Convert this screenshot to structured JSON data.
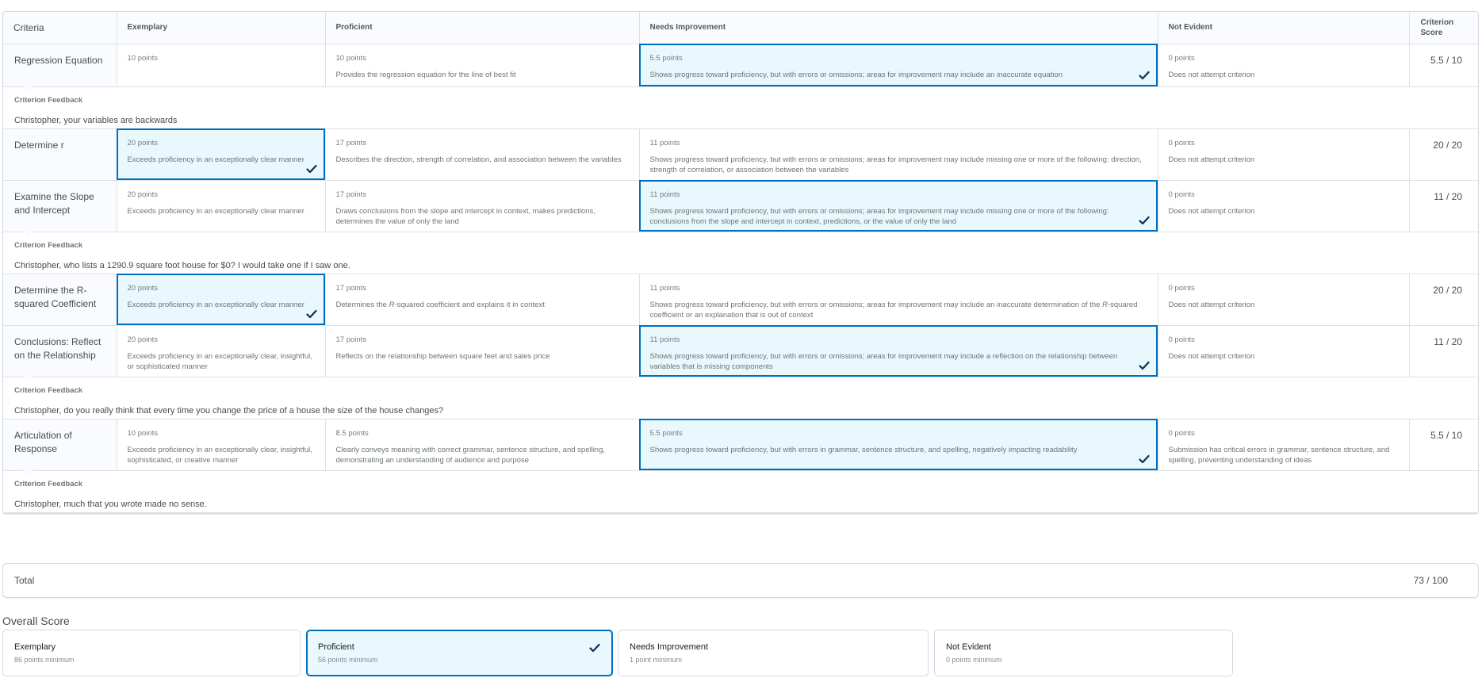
{
  "headers": {
    "criteria": "Criteria",
    "levels": [
      "Exemplary",
      "Proficient",
      "Needs Improvement",
      "Not Evident"
    ],
    "score": "Criterion Score"
  },
  "criteria": [
    {
      "name": "Regression Equation",
      "score": "5.5 / 10",
      "selected": 2,
      "cells": [
        {
          "points": "10 points",
          "desc": ""
        },
        {
          "points": "10 points",
          "desc": "Provides the regression equation for the line of best fit"
        },
        {
          "points": "5.5 points",
          "desc": "Shows progress toward proficiency, but with errors or omissions; areas for improvement may include an inaccurate equation"
        },
        {
          "points": "0 points",
          "desc": "Does not attempt criterion"
        }
      ],
      "feedback": "Christopher, your variables are backwards"
    },
    {
      "name": "Determine r",
      "score": "20 / 20",
      "selected": 0,
      "cells": [
        {
          "points": "20 points",
          "desc": "Exceeds proficiency in an exceptionally clear manner"
        },
        {
          "points": "17 points",
          "desc": "Describes the direction, strength of correlation, and association between the variables"
        },
        {
          "points": "11 points",
          "desc": "Shows progress toward proficiency, but with errors or omissions; areas for improvement may include missing one or more of the following: direction, strength of correlation, or association between the variables"
        },
        {
          "points": "0 points",
          "desc": "Does not attempt criterion"
        }
      ],
      "feedback": ""
    },
    {
      "name": "Examine the Slope and Intercept",
      "score": "11 / 20",
      "selected": 2,
      "cells": [
        {
          "points": "20 points",
          "desc": "Exceeds proficiency in an exceptionally clear manner"
        },
        {
          "points": "17 points",
          "desc": "Draws conclusions from the slope and intercept in context, makes predictions, determines the value of only the land"
        },
        {
          "points": "11 points",
          "desc": "Shows progress toward proficiency, but with errors or omissions; areas for improvement may include missing one or more of the following: conclusions from the slope and intercept in context, predictions, or the value of only the land"
        },
        {
          "points": "0 points",
          "desc": "Does not attempt criterion"
        }
      ],
      "feedback": "Christopher, who lists a 1290.9 square foot house for $0? I would take one if I saw one."
    },
    {
      "name": "Determine the R-squared Coefficient",
      "score": "20 / 20",
      "selected": 0,
      "cells": [
        {
          "points": "20 points",
          "desc": "Exceeds proficiency in an exceptionally clear manner"
        },
        {
          "points": "17 points",
          "desc": "Determines the R-squared coefficient and explains it in context"
        },
        {
          "points": "11 points",
          "desc": "Shows progress toward proficiency, but with errors or omissions; areas for improvement may include an inaccurate determination of the R-squared coefficient or an explanation that is out of context"
        },
        {
          "points": "0 points",
          "desc": "Does not attempt criterion"
        }
      ],
      "feedback": ""
    },
    {
      "name": "Conclusions: Reflect on the Relationship",
      "score": "11 / 20",
      "selected": 2,
      "cells": [
        {
          "points": "20 points",
          "desc": "Exceeds proficiency in an exceptionally clear, insightful, or sophisticated manner"
        },
        {
          "points": "17 points",
          "desc": "Reflects on the relationship between square feet and sales price"
        },
        {
          "points": "11 points",
          "desc": "Shows progress toward proficiency, but with errors or omissions; areas for improvement may include a reflection on the relationship between variables that is missing components"
        },
        {
          "points": "0 points",
          "desc": "Does not attempt criterion"
        }
      ],
      "feedback": "Christopher, do you really think that every time you change the price of a house the size of the house changes?"
    },
    {
      "name": "Articulation of Response",
      "score": "5.5 / 10",
      "selected": 2,
      "cells": [
        {
          "points": "10 points",
          "desc": "Exceeds proficiency in an exceptionally clear, insightful, sophisticated, or creative manner"
        },
        {
          "points": "8.5 points",
          "desc": "Clearly conveys meaning with correct grammar, sentence structure, and spelling, demonstrating an understanding of audience and purpose"
        },
        {
          "points": "5.5 points",
          "desc": "Shows progress toward proficiency, but with errors in grammar, sentence structure, and spelling, negatively impacting readability"
        },
        {
          "points": "0 points",
          "desc": "Submission has critical errors in grammar, sentence structure, and spelling, preventing understanding of ideas"
        }
      ],
      "feedback": "Christopher, much that you wrote made no sense."
    }
  ],
  "feedback_label": "Criterion Feedback",
  "total": {
    "label": "Total",
    "score": "73 / 100"
  },
  "overall": {
    "title": "Overall Score",
    "selected": 1,
    "levels": [
      {
        "name": "Exemplary",
        "min": "86 points minimum"
      },
      {
        "name": "Proficient",
        "min": "56 points minimum"
      },
      {
        "name": "Needs Improvement",
        "min": "1 point minimum"
      },
      {
        "name": "Not Evident",
        "min": "0 points minimum"
      }
    ]
  },
  "colors": {
    "selected_bg": "#e8f8fd",
    "selected_border": "#006fbf",
    "check": "#0a2f52"
  },
  "icons": {
    "selected_check": "check-icon"
  }
}
